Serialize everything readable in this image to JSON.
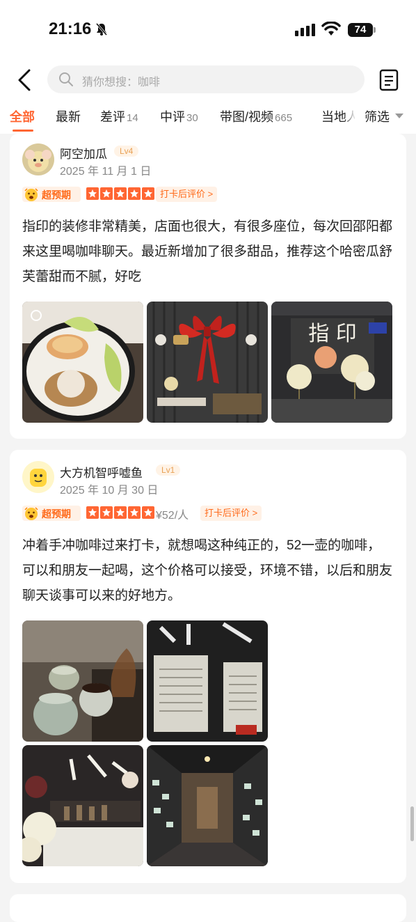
{
  "status": {
    "time": "21:16",
    "battery": "74"
  },
  "search": {
    "placeholder": "猜你想搜：咖啡"
  },
  "tabs": [
    {
      "label": "全部",
      "count": ""
    },
    {
      "label": "最新",
      "count": ""
    },
    {
      "label": "差评",
      "count": "14"
    },
    {
      "label": "中评",
      "count": "30"
    },
    {
      "label": "带图/视频",
      "count": "665"
    },
    {
      "label": "当地人",
      "count": ""
    }
  ],
  "filter_label": "筛选",
  "reviews": [
    {
      "username": "阿空加瓜",
      "level": "Lv4",
      "date": "2025 年 11 月 1 日",
      "badge": "超预期",
      "stars": 5,
      "price": "",
      "checkin": "打卡后评价 >",
      "text": "指印的装修非常精美，店面也很大，有很多座位，每次回邵阳都来这里喝咖啡聊天。最近新增加了很多甜品，推荐这个哈密瓜舒芙蕾甜而不腻，好吃"
    },
    {
      "username": "大方机智呼嘘鱼",
      "level": "Lv1",
      "date": "2025 年 10 月 30 日",
      "badge": "超预期",
      "stars": 5,
      "price": "¥52/人",
      "checkin": "打卡后评价 >",
      "text": "冲着手冲咖啡过来打卡，就想喝这种纯正的，52一壶的咖啡，可以和朋友一起喝，这个价格可以接受，环境不错，以后和朋友聊天谈事可以来的好地方。"
    }
  ],
  "photo_signs": {
    "shop_sign": "指 印"
  },
  "colors": {
    "accent": "#ff6633",
    "badge_bg": "#fff1e6",
    "page_bg": "#f4f4f4"
  }
}
